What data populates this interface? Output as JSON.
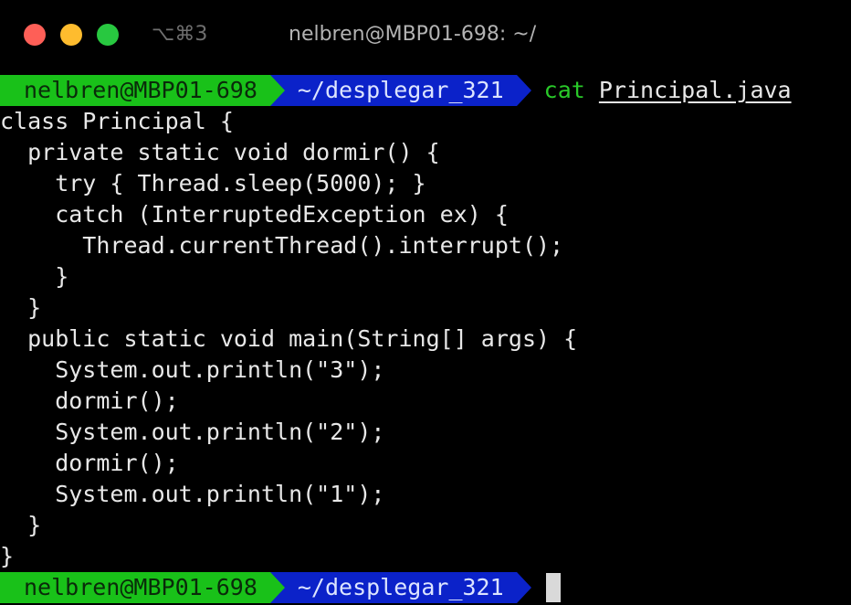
{
  "window": {
    "shortcut": "⌥⌘3",
    "title": "nelbren@MBP01-698: ~/"
  },
  "prompt": {
    "user_host": "nelbren@MBP01-698",
    "path": "~/desplegar_321"
  },
  "command": {
    "name": "cat",
    "argument": "Principal.java"
  },
  "output_lines": [
    "class Principal {",
    "  private static void dormir() {",
    "    try { Thread.sleep(5000); }",
    "    catch (InterruptedException ex) {",
    "      Thread.currentThread().interrupt();",
    "    }",
    "  }",
    "  public static void main(String[] args) {",
    "    System.out.println(\"3\");",
    "    dormir();",
    "    System.out.println(\"2\");",
    "    dormir();",
    "    System.out.println(\"1\");",
    "  }",
    "}"
  ],
  "colors": {
    "user_segment": "#19c119",
    "path_segment": "#0b22c9",
    "command": "#29c929",
    "background": "#000000"
  }
}
